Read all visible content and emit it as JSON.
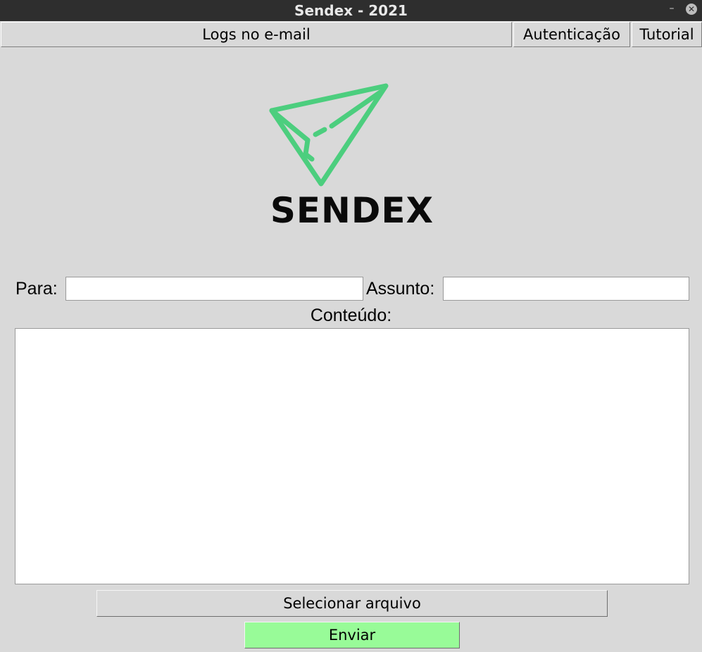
{
  "window": {
    "title": "Sendex - 2021",
    "minimize_glyph": "–",
    "close_glyph": "✕"
  },
  "menu": {
    "logs_label": "Logs no e-mail",
    "auth_label": "Autenticação",
    "tutorial_label": "Tutorial"
  },
  "logo": {
    "text": "SENDEX",
    "icon": "paper-plane-icon",
    "icon_color": "#4cce7e"
  },
  "form": {
    "para_label": "Para:",
    "para_value": "",
    "assunto_label": "Assunto:",
    "assunto_value": "",
    "conteudo_label": "Conteúdo:",
    "conteudo_value": ""
  },
  "actions": {
    "select_file_label": "Selecionar arquivo",
    "send_label": "Enviar",
    "send_color": "#98fb98"
  }
}
